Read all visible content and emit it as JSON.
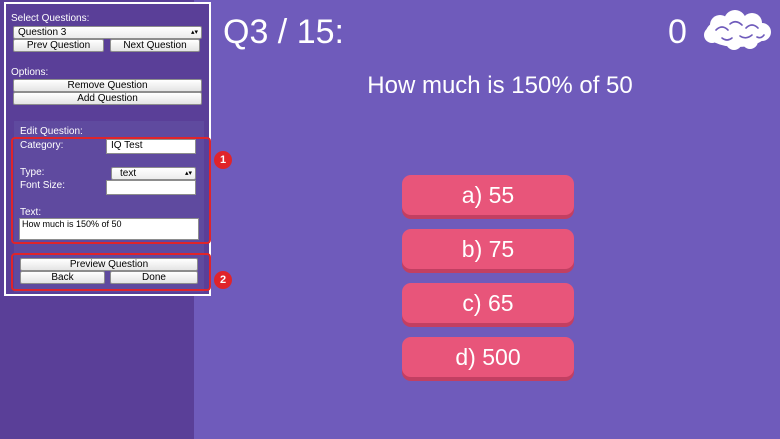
{
  "editor": {
    "select_label": "Select Questions:",
    "question_select": "Question 3",
    "prev_button": "Prev Question",
    "next_button": "Next Question",
    "options_label": "Options:",
    "remove_button": "Remove Question",
    "add_button": "Add Question",
    "edit_label": "Edit Question:",
    "category_label": "Category:",
    "category_value": "IQ Test",
    "type_label": "Type:",
    "type_value": "text",
    "font_size_label": "Font Size:",
    "font_size_value": "",
    "text_label": "Text:",
    "text_value": "How much is 150% of 50",
    "preview_button": "Preview Question",
    "back_button": "Back",
    "done_button": "Done"
  },
  "annotations": {
    "badge1": "1",
    "badge2": "2",
    "color": "#e0242a"
  },
  "quiz": {
    "progress": "Q3 / 15:",
    "score": "0",
    "question": "How much is 150% of 50",
    "answers": [
      "a) 55",
      "b) 75",
      "c) 65",
      "d) 500"
    ]
  },
  "colors": {
    "background": "#6f5bbb",
    "sidebar": "#5a3f98",
    "answer": "#e8557a",
    "answer_shadow": "#c23f62"
  },
  "icons": {
    "score_icon": "brain-icon",
    "select_arrow": "updown-arrow-icon"
  }
}
